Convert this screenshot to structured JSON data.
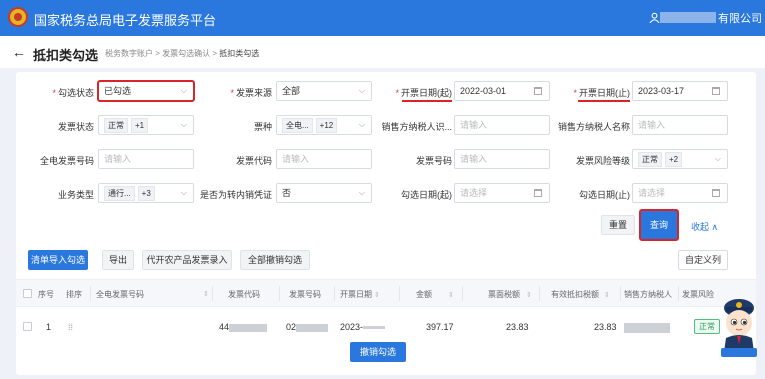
{
  "header": {
    "title": "国家税务总局电子发票服务平台",
    "company_suffix": "有限公司"
  },
  "breadcrumb": {
    "page_title": "抵扣类勾选",
    "items": [
      "税务数字账户",
      "发票勾选确认",
      "抵扣类勾选"
    ],
    "sep": ">"
  },
  "filters": {
    "check_status": {
      "label": "勾选状态",
      "value": "已勾选"
    },
    "invoice_source": {
      "label": "发票来源",
      "value": "全部"
    },
    "issue_date_start": {
      "label": "开票日期(起)",
      "value": "2022-03-01"
    },
    "issue_date_end": {
      "label": "开票日期(止)",
      "value": "2023-03-17"
    },
    "invoice_status": {
      "label": "发票状态",
      "tag": "正常",
      "more": "+1"
    },
    "ticket_type": {
      "label": "票种",
      "tag": "全电...",
      "more": "+12"
    },
    "seller_tax_id": {
      "label": "销售方纳税人识...",
      "placeholder": "请输入"
    },
    "seller_name": {
      "label": "销售方纳税人名称",
      "placeholder": "请输入"
    },
    "full_invoice_no": {
      "label": "全电发票号码",
      "placeholder": "请输入"
    },
    "invoice_code": {
      "label": "发票代码",
      "placeholder": "请输入"
    },
    "invoice_no": {
      "label": "发票号码",
      "placeholder": "请输入"
    },
    "risk_level": {
      "label": "发票风险等级",
      "tag": "正常",
      "more": "+2"
    },
    "business_type": {
      "label": "业务类型",
      "tag": "通行...",
      "more": "+3"
    },
    "is_transfer": {
      "label": "是否为转内销凭证",
      "value": "否"
    },
    "check_date_start": {
      "label": "勾选日期(起)",
      "placeholder": "请选择"
    },
    "check_date_end": {
      "label": "勾选日期(止)",
      "placeholder": "请选择"
    }
  },
  "actions": {
    "reset": "重置",
    "query": "查询",
    "collapse": "收起"
  },
  "toolbar": {
    "import_check": "清单导入勾选",
    "export": "导出",
    "agri_entry": "代开农产品发票录入",
    "undo_all": "全部撤销勾选",
    "custom_cols": "自定义列"
  },
  "table": {
    "headers": [
      "序号",
      "排序",
      "全电发票号码",
      "发票代码",
      "发票号码",
      "开票日期",
      "金额",
      "票面税额",
      "有效抵扣税额",
      "销售方纳税人",
      "发票风险"
    ],
    "row": {
      "index": "1",
      "code_prefix": "44",
      "number_prefix": "02",
      "date_prefix": "2023-",
      "amount": "397.17",
      "tax": "23.83",
      "effective_tax": "23.83",
      "status": "正常"
    }
  },
  "float_button": "撤销勾选",
  "colors": {
    "primary": "#2a78de",
    "highlight": "#d9242a"
  },
  "icons": [
    "back-arrow-icon",
    "user-icon",
    "calendar-icon",
    "chevron-down-icon",
    "sort-icon",
    "drag-handle-icon",
    "logo-icon",
    "mascot-icon"
  ]
}
